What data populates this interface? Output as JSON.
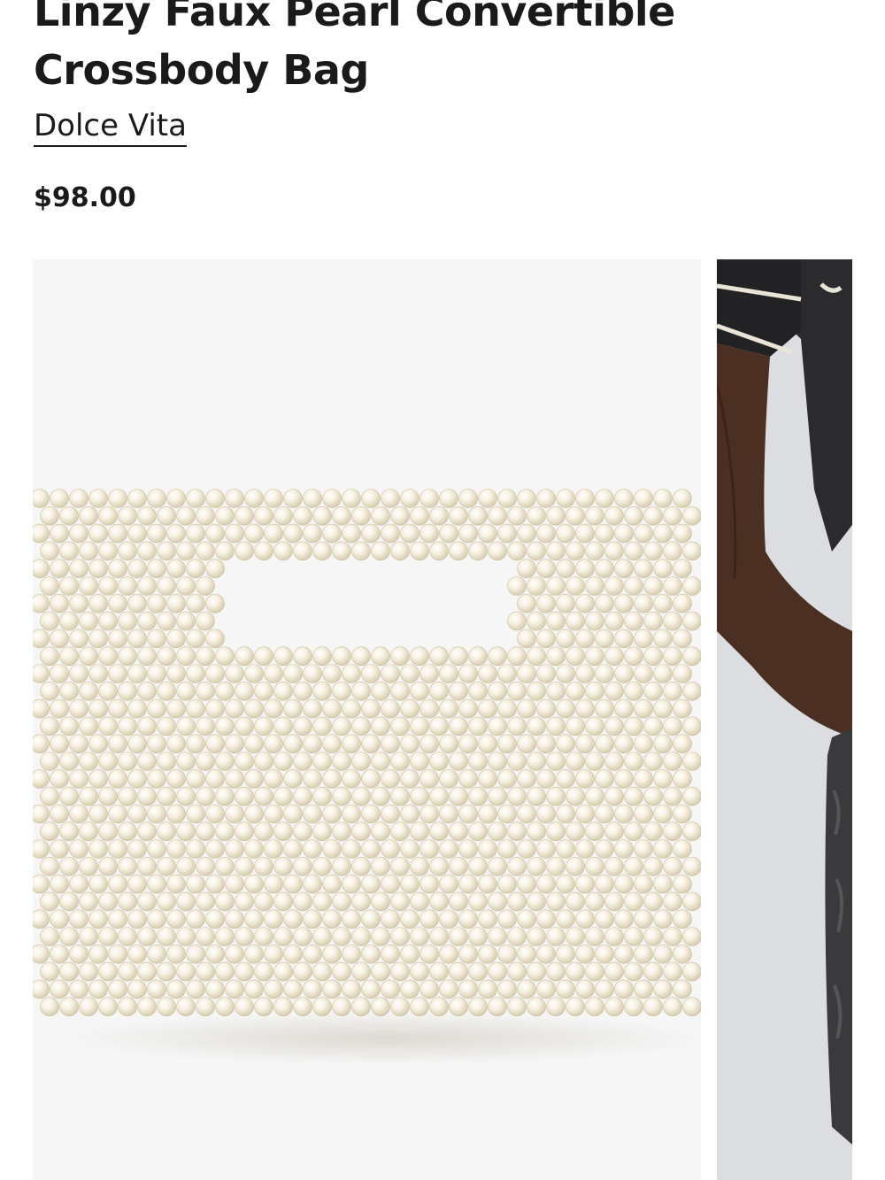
{
  "product": {
    "title": "Linzy Faux Pearl Convertible Crossbody Bag",
    "brand": "Dolce Vita",
    "price": "$98.00"
  },
  "gallery": {
    "images": [
      {
        "subject": "pearl-bag-product-photo"
      },
      {
        "subject": "model-holding-bag-photo"
      }
    ]
  },
  "colors": {
    "text": "#1a1a1a",
    "image_bg": "#f6f6f6",
    "pearl": "#f3ecd8"
  }
}
